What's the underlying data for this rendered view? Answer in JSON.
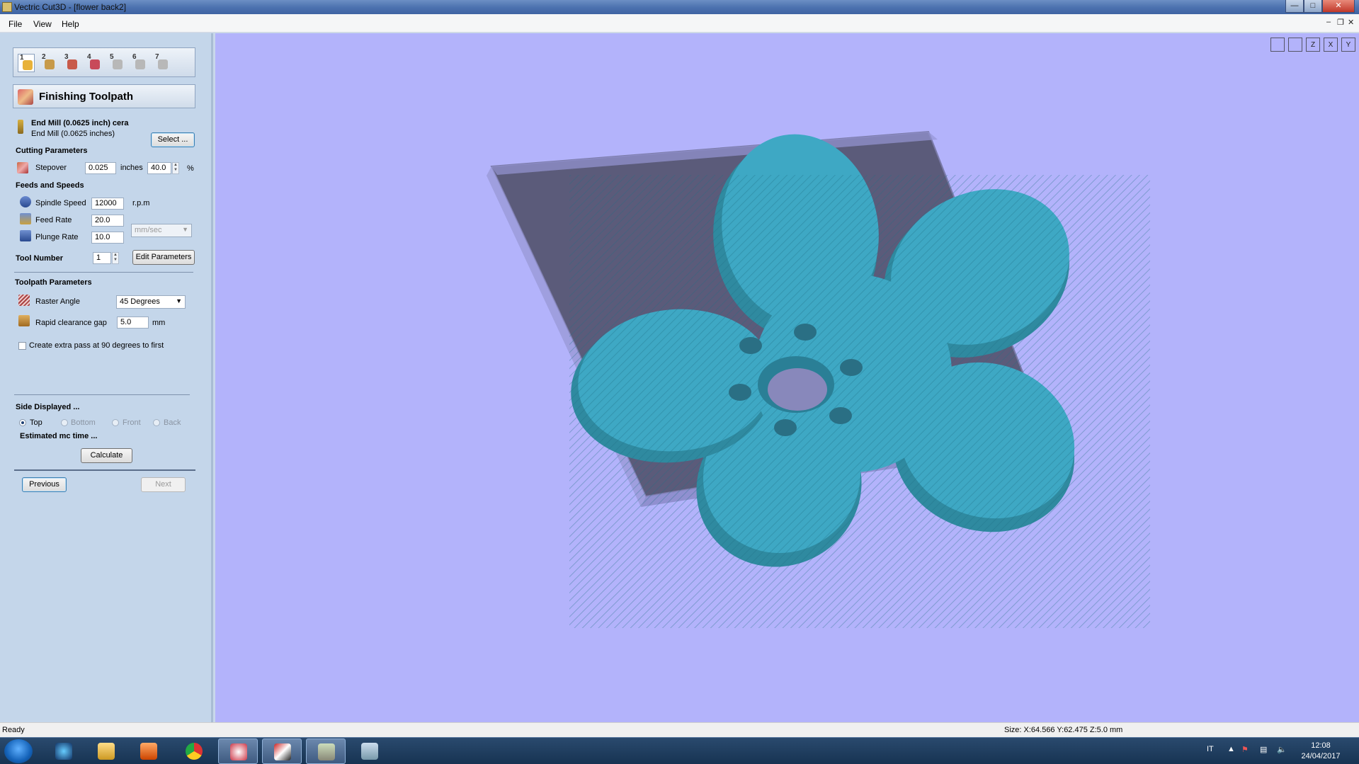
{
  "window": {
    "title": "Vectric Cut3D - [flower back2]"
  },
  "menu": {
    "file": "File",
    "view": "View",
    "help": "Help"
  },
  "steps": [
    {
      "label": "1",
      "icon": "open-folder-icon",
      "color": "#e8b23a"
    },
    {
      "label": "2",
      "icon": "orient-model-icon",
      "color": "#c79a4a"
    },
    {
      "label": "3",
      "icon": "roughing-toolpath-icon",
      "color": "#c85a4a"
    },
    {
      "label": "4",
      "icon": "finishing-toolpath-icon",
      "color": "#c84a5a"
    },
    {
      "label": "5",
      "icon": "cutout-toolpath-icon",
      "color": "#b8b8b8"
    },
    {
      "label": "6",
      "icon": "preview-icon",
      "color": "#b8b8b8"
    },
    {
      "label": "7",
      "icon": "save-toolpath-icon",
      "color": "#b8b8b8"
    }
  ],
  "section": {
    "title": "Finishing Toolpath"
  },
  "tool": {
    "name": "End Mill (0.0625 inch) cera",
    "desc": "End Mill (0.0625 inches)",
    "select_label": "Select ..."
  },
  "cutting": {
    "heading": "Cutting Parameters",
    "stepover_label": "Stepover",
    "stepover_value": "0.025",
    "stepover_unit": "inches",
    "stepover_pct": "40.0",
    "pct_symbol": "%"
  },
  "feeds": {
    "heading": "Feeds and Speeds",
    "spindle_label": "Spindle Speed",
    "spindle_value": "12000",
    "spindle_unit": "r.p.m",
    "feed_label": "Feed Rate",
    "feed_value": "20.0",
    "plunge_label": "Plunge Rate",
    "plunge_value": "10.0",
    "rate_unit": "mm/sec",
    "tool_number_label": "Tool Number",
    "tool_number_value": "1",
    "edit_params_label": "Edit Parameters"
  },
  "toolpath": {
    "heading": "Toolpath Parameters",
    "raster_label": "Raster Angle",
    "raster_value": "45 Degrees",
    "clearance_label": "Rapid clearance gap",
    "clearance_value": "5.0",
    "clearance_unit": "mm",
    "extra_pass_label": "Create extra pass at 90 degrees to first"
  },
  "side": {
    "heading": "Side Displayed ...",
    "options": [
      "Top",
      "Bottom",
      "Front",
      "Back"
    ],
    "selected": "Top",
    "est_label": "Estimated mc time ...",
    "calculate_label": "Calculate"
  },
  "nav": {
    "previous": "Previous",
    "next": "Next"
  },
  "view_icons": [
    "zoom-extents-icon",
    "iso-view-icon",
    "view-z-icon",
    "view-x-icon",
    "view-y-icon"
  ],
  "view_icon_labels": [
    "",
    "",
    "Z",
    "X",
    "Y"
  ],
  "status": {
    "left": "Ready",
    "right": "Size: X:64.566 Y:62.475 Z:5.0 mm"
  },
  "taskbar": {
    "lang": "IT",
    "time": "12:08",
    "date": "24/04/2017"
  },
  "colors": {
    "viewport": "#b3b3fb",
    "model": "#3ea8c4",
    "base": "#5b5b7a"
  }
}
